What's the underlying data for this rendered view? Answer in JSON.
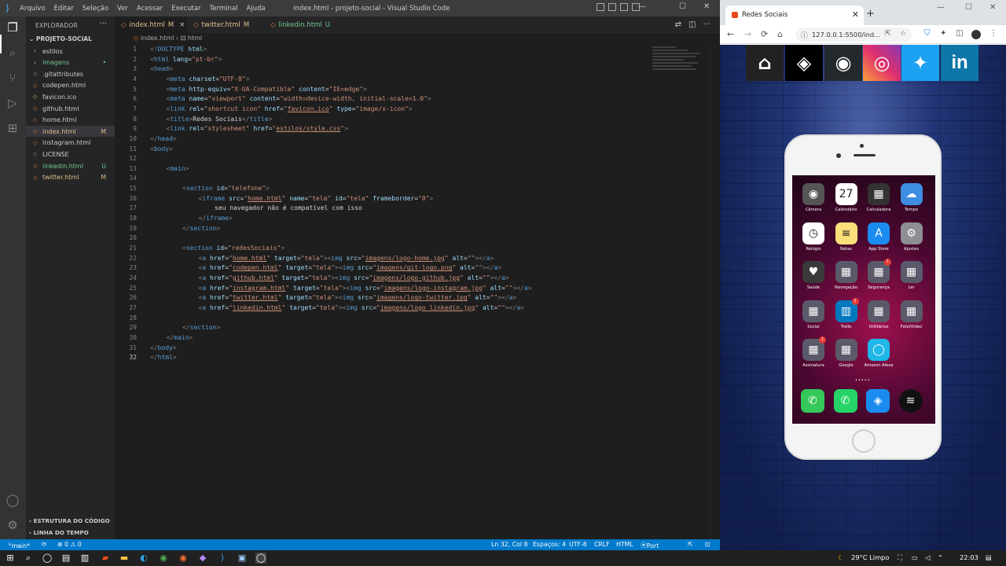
{
  "vscode": {
    "menu": [
      "Arquivo",
      "Editar",
      "Seleção",
      "Ver",
      "Acessar",
      "Executar",
      "Terminal",
      "Ajuda"
    ],
    "window_title": "index.html - projeto-social - Visual Studio Code",
    "explorer_header": "EXPLORADOR",
    "project_name": "PROJETO-SOCIAL",
    "tree": [
      {
        "name": "estilos",
        "type": "folder",
        "badge": "",
        "color": "#cccccc"
      },
      {
        "name": "imagens",
        "type": "folder",
        "badge": "•",
        "color": "#73c991"
      },
      {
        "name": ".gitattributes",
        "type": "file",
        "badge": "",
        "color": "#cccccc"
      },
      {
        "name": "codepen.html",
        "type": "file",
        "badge": "",
        "color": "#cccccc"
      },
      {
        "name": "favicon.ico",
        "type": "file",
        "badge": "",
        "color": "#cccccc"
      },
      {
        "name": "github.html",
        "type": "file",
        "badge": "",
        "color": "#cccccc"
      },
      {
        "name": "home.html",
        "type": "file",
        "badge": "",
        "color": "#cccccc"
      },
      {
        "name": "index.html",
        "type": "file",
        "badge": "M",
        "color": "#e2c08d"
      },
      {
        "name": "instagram.html",
        "type": "file",
        "badge": "",
        "color": "#cccccc"
      },
      {
        "name": "LICENSE",
        "type": "file",
        "badge": "",
        "color": "#cccccc"
      },
      {
        "name": "linkedin.html",
        "type": "file",
        "badge": "U",
        "color": "#73c991"
      },
      {
        "name": "twitter.html",
        "type": "file",
        "badge": "M",
        "color": "#e2c08d"
      }
    ],
    "outline_section": "ESTRUTURA DO CÓDIGO",
    "timeline_section": "LINHA DO TEMPO",
    "tabs": [
      {
        "label": "index.html",
        "mod": "M",
        "close": "×",
        "color": "#e2c08d"
      },
      {
        "label": "twitter.html",
        "mod": "M",
        "close": "",
        "color": "#e2c08d"
      },
      {
        "label": "linkedin.html",
        "mod": "U",
        "close": "",
        "color": "#73c991"
      }
    ],
    "breadcrumb": {
      "file": "index.html",
      "sep": "›",
      "node": "html"
    },
    "code_lines": [
      "1",
      "2",
      "3",
      "4",
      "5",
      "6",
      "7",
      "8",
      "9",
      "10",
      "11",
      "12",
      "13",
      "14",
      "15",
      "16",
      "17",
      "18",
      "19",
      "20",
      "21",
      "22",
      "23",
      "24",
      "25",
      "26",
      "27",
      "28",
      "29",
      "30",
      "31",
      "32"
    ],
    "status": {
      "branch": "main*",
      "errors": "⊗ 0 ⚠ 0",
      "position": "Ln 32, Col 8",
      "spaces": "Espaços: 4",
      "encoding": "UTF-8",
      "eol": "CRLF",
      "language": "HTML",
      "port": "Port : 5500"
    }
  },
  "browser": {
    "tab_title": "Redes Sociais",
    "url": "127.0.0.1:5500/ind...",
    "social_icons": [
      "home-icon",
      "codepen-icon",
      "github-icon",
      "instagram-icon",
      "twitter-icon",
      "linkedin-icon"
    ],
    "linkedin_text": "in",
    "apps": [
      {
        "label": "Câmera",
        "glyph": "◉",
        "bg": "#555555"
      },
      {
        "label": "Calendário",
        "glyph": "27",
        "bg": "#ffffff"
      },
      {
        "label": "Calculadora",
        "glyph": "▦",
        "bg": "#333333"
      },
      {
        "label": "Tempo",
        "glyph": "☁",
        "bg": "#3d8de0"
      },
      {
        "label": "Relógio",
        "glyph": "◷",
        "bg": "#ffffff"
      },
      {
        "label": "Notas",
        "glyph": "≡",
        "bg": "#fbe07a"
      },
      {
        "label": "App Store",
        "glyph": "A",
        "bg": "#1a8cf0"
      },
      {
        "label": "Ajustes",
        "glyph": "⚙",
        "bg": "#8e8e93"
      },
      {
        "label": "Saúde",
        "glyph": "♥",
        "bg": "#3a3a3a"
      },
      {
        "label": "Navegação",
        "glyph": "▦",
        "bg": "#5a5a6a"
      },
      {
        "label": "Segurança",
        "glyph": "▦",
        "bg": "#5a5a6a"
      },
      {
        "label": "Ler",
        "glyph": "▦",
        "bg": "#5a5a6a"
      },
      {
        "label": "Social",
        "glyph": "▦",
        "bg": "#5a5a6a"
      },
      {
        "label": "Trello",
        "glyph": "▥",
        "bg": "#0079bf"
      },
      {
        "label": "Utilitários",
        "glyph": "▦",
        "bg": "#5a5a6a"
      },
      {
        "label": "Foto/Vídeo",
        "glyph": "▦",
        "bg": "#5a5a6a"
      },
      {
        "label": "Assinatura",
        "glyph": "▦",
        "bg": "#5a5a6a"
      },
      {
        "label": "Google",
        "glyph": "▦",
        "bg": "#5a5a6a"
      },
      {
        "label": "Amazon Alexa",
        "glyph": "◯",
        "bg": "#1fb6e8"
      }
    ],
    "badges": {
      "saude": "",
      "seguranca": "1",
      "social": "",
      "trello": "1",
      "assinatura": "1"
    },
    "dock": [
      {
        "name": "phone-icon",
        "glyph": "✆",
        "bg": "#34c759"
      },
      {
        "name": "whatsapp-icon",
        "glyph": "✆",
        "bg": "#25d366"
      },
      {
        "name": "safari-icon",
        "glyph": "◈",
        "bg": "#1a8cf0"
      },
      {
        "name": "spotify-icon",
        "glyph": "≋",
        "bg": "#111111"
      }
    ]
  },
  "taskbar": {
    "weather": "29°C  Limpo",
    "time": "22:03"
  }
}
